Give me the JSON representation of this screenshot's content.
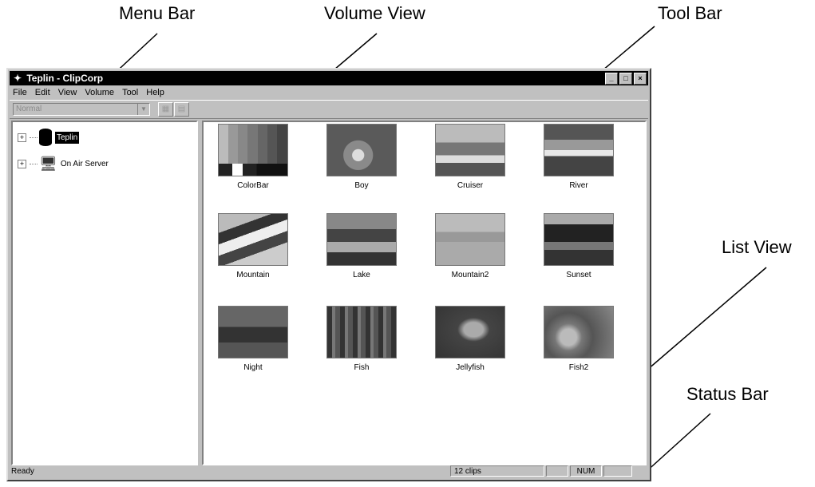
{
  "callouts": {
    "menu_bar": "Menu Bar",
    "volume_view": "Volume View",
    "tool_bar": "Tool Bar",
    "list_view": "List View",
    "status_bar": "Status Bar"
  },
  "window": {
    "title": "Teplin - ClipCorp",
    "buttons": [
      "_",
      "□",
      "×"
    ]
  },
  "menu": {
    "items": [
      "File",
      "Edit",
      "View",
      "Volume",
      "Tool",
      "Help"
    ]
  },
  "toolbar": {
    "combo_value": "Normal"
  },
  "tree": {
    "items": [
      {
        "label": "Teplin",
        "icon": "database-icon",
        "selected": true
      },
      {
        "label": "On Air Server",
        "icon": "computer-icon",
        "selected": false
      }
    ]
  },
  "clips": [
    {
      "label": "ColorBar"
    },
    {
      "label": "Boy"
    },
    {
      "label": "Cruiser"
    },
    {
      "label": "River"
    },
    {
      "label": "Mountain"
    },
    {
      "label": "Lake"
    },
    {
      "label": "Mountain2"
    },
    {
      "label": "Sunset"
    },
    {
      "label": "Night"
    },
    {
      "label": "Fish"
    },
    {
      "label": "Jellyfish"
    },
    {
      "label": "Fish2"
    }
  ],
  "status": {
    "ready": "Ready",
    "clips": "12 clips",
    "num": "NUM"
  }
}
